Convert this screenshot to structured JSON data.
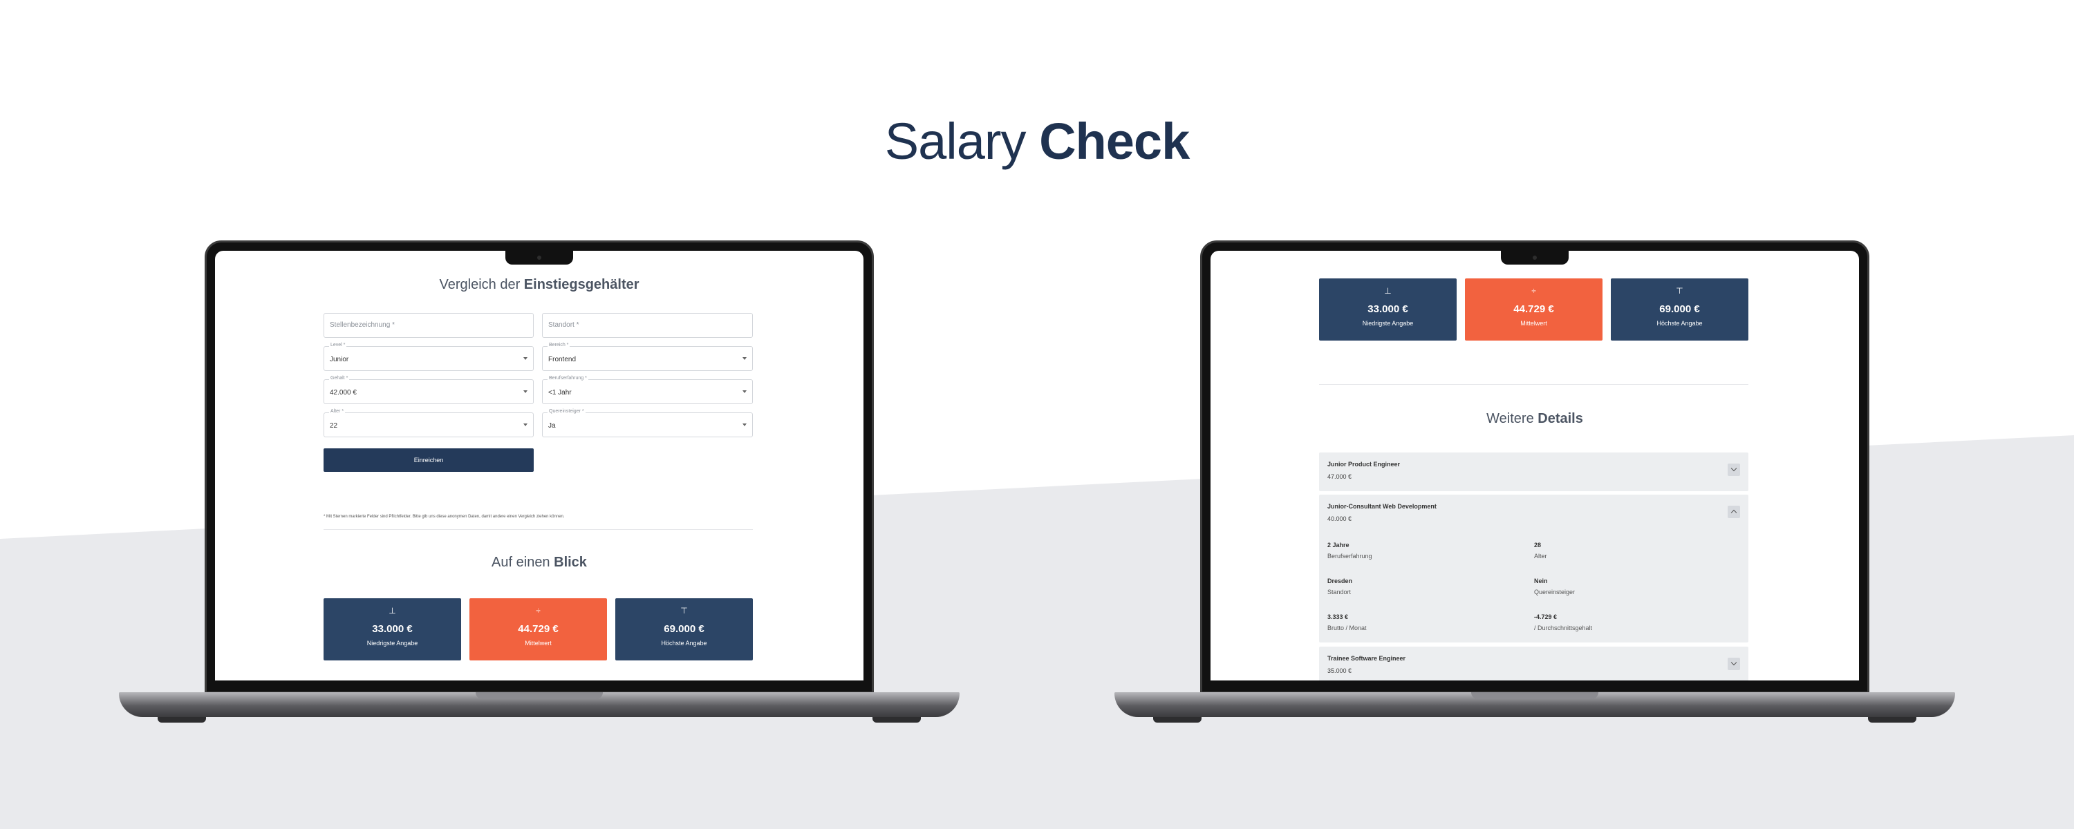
{
  "title": {
    "light": "Salary",
    "bold": "Check"
  },
  "left_screen": {
    "heading": {
      "light": "Vergleich der",
      "bold": "Einstiegsgehälter"
    },
    "fields": {
      "job_title": {
        "placeholder": "Stellenbezeichnung *"
      },
      "location": {
        "placeholder": "Standort *"
      },
      "level": {
        "label": "Level *",
        "value": "Junior"
      },
      "area": {
        "label": "Bereich *",
        "value": "Frontend"
      },
      "salary": {
        "label": "Gehalt *",
        "value": "42.000 €"
      },
      "experience": {
        "label": "Berufserfahrung *",
        "value": "<1 Jahr"
      },
      "age": {
        "label": "Alter *",
        "value": "22"
      },
      "career_changer": {
        "label": "Quereinsteiger *",
        "value": "Ja"
      }
    },
    "submit_label": "Einreichen",
    "footnote": "* Mit Sternen markierte Felder sind Pflichtfelder. Bitte gib uns diese anonymen Daten, damit andere einen Vergleich ziehen können.",
    "overview_heading": {
      "light": "Auf einen",
      "bold": "Blick"
    },
    "cards": [
      {
        "icon": "⊥",
        "amount": "33.000 €",
        "caption": "Niedrigste Angabe",
        "color": "#2c4566"
      },
      {
        "icon": "÷",
        "amount": "44.729 €",
        "caption": "Mittelwert",
        "color": "#f2623f"
      },
      {
        "icon": "⊤",
        "amount": "69.000 €",
        "caption": "Höchste Angabe",
        "color": "#2c4566"
      }
    ]
  },
  "right_screen": {
    "cards": [
      {
        "icon": "⊥",
        "amount": "33.000 €",
        "caption": "Niedrigste Angabe",
        "color": "#2c4566"
      },
      {
        "icon": "÷",
        "amount": "44.729 €",
        "caption": "Mittelwert",
        "color": "#f2623f"
      },
      {
        "icon": "⊤",
        "amount": "69.000 €",
        "caption": "Höchste Angabe",
        "color": "#2c4566"
      }
    ],
    "details_heading": {
      "light": "Weitere",
      "bold": "Details"
    },
    "entries": [
      {
        "title": "Junior Product Engineer",
        "salary": "47.000 €",
        "expanded": false
      },
      {
        "title": "Junior-Consultant Web Development",
        "salary": "40.000 €",
        "expanded": true,
        "details": [
          {
            "value": "2 Jahre",
            "key": "Berufserfahrung"
          },
          {
            "value": "28",
            "key": "Alter"
          },
          {
            "value": "Dresden",
            "key": "Standort"
          },
          {
            "value": "Nein",
            "key": "Quereinsteiger"
          },
          {
            "value": "3.333 €",
            "key": "Brutto / Monat"
          },
          {
            "value": "-4.729 €",
            "key": "/ Durchschnittsgehalt"
          }
        ]
      },
      {
        "title": "Trainee Software Engineer",
        "salary": "35.000 €",
        "expanded": false
      }
    ]
  }
}
